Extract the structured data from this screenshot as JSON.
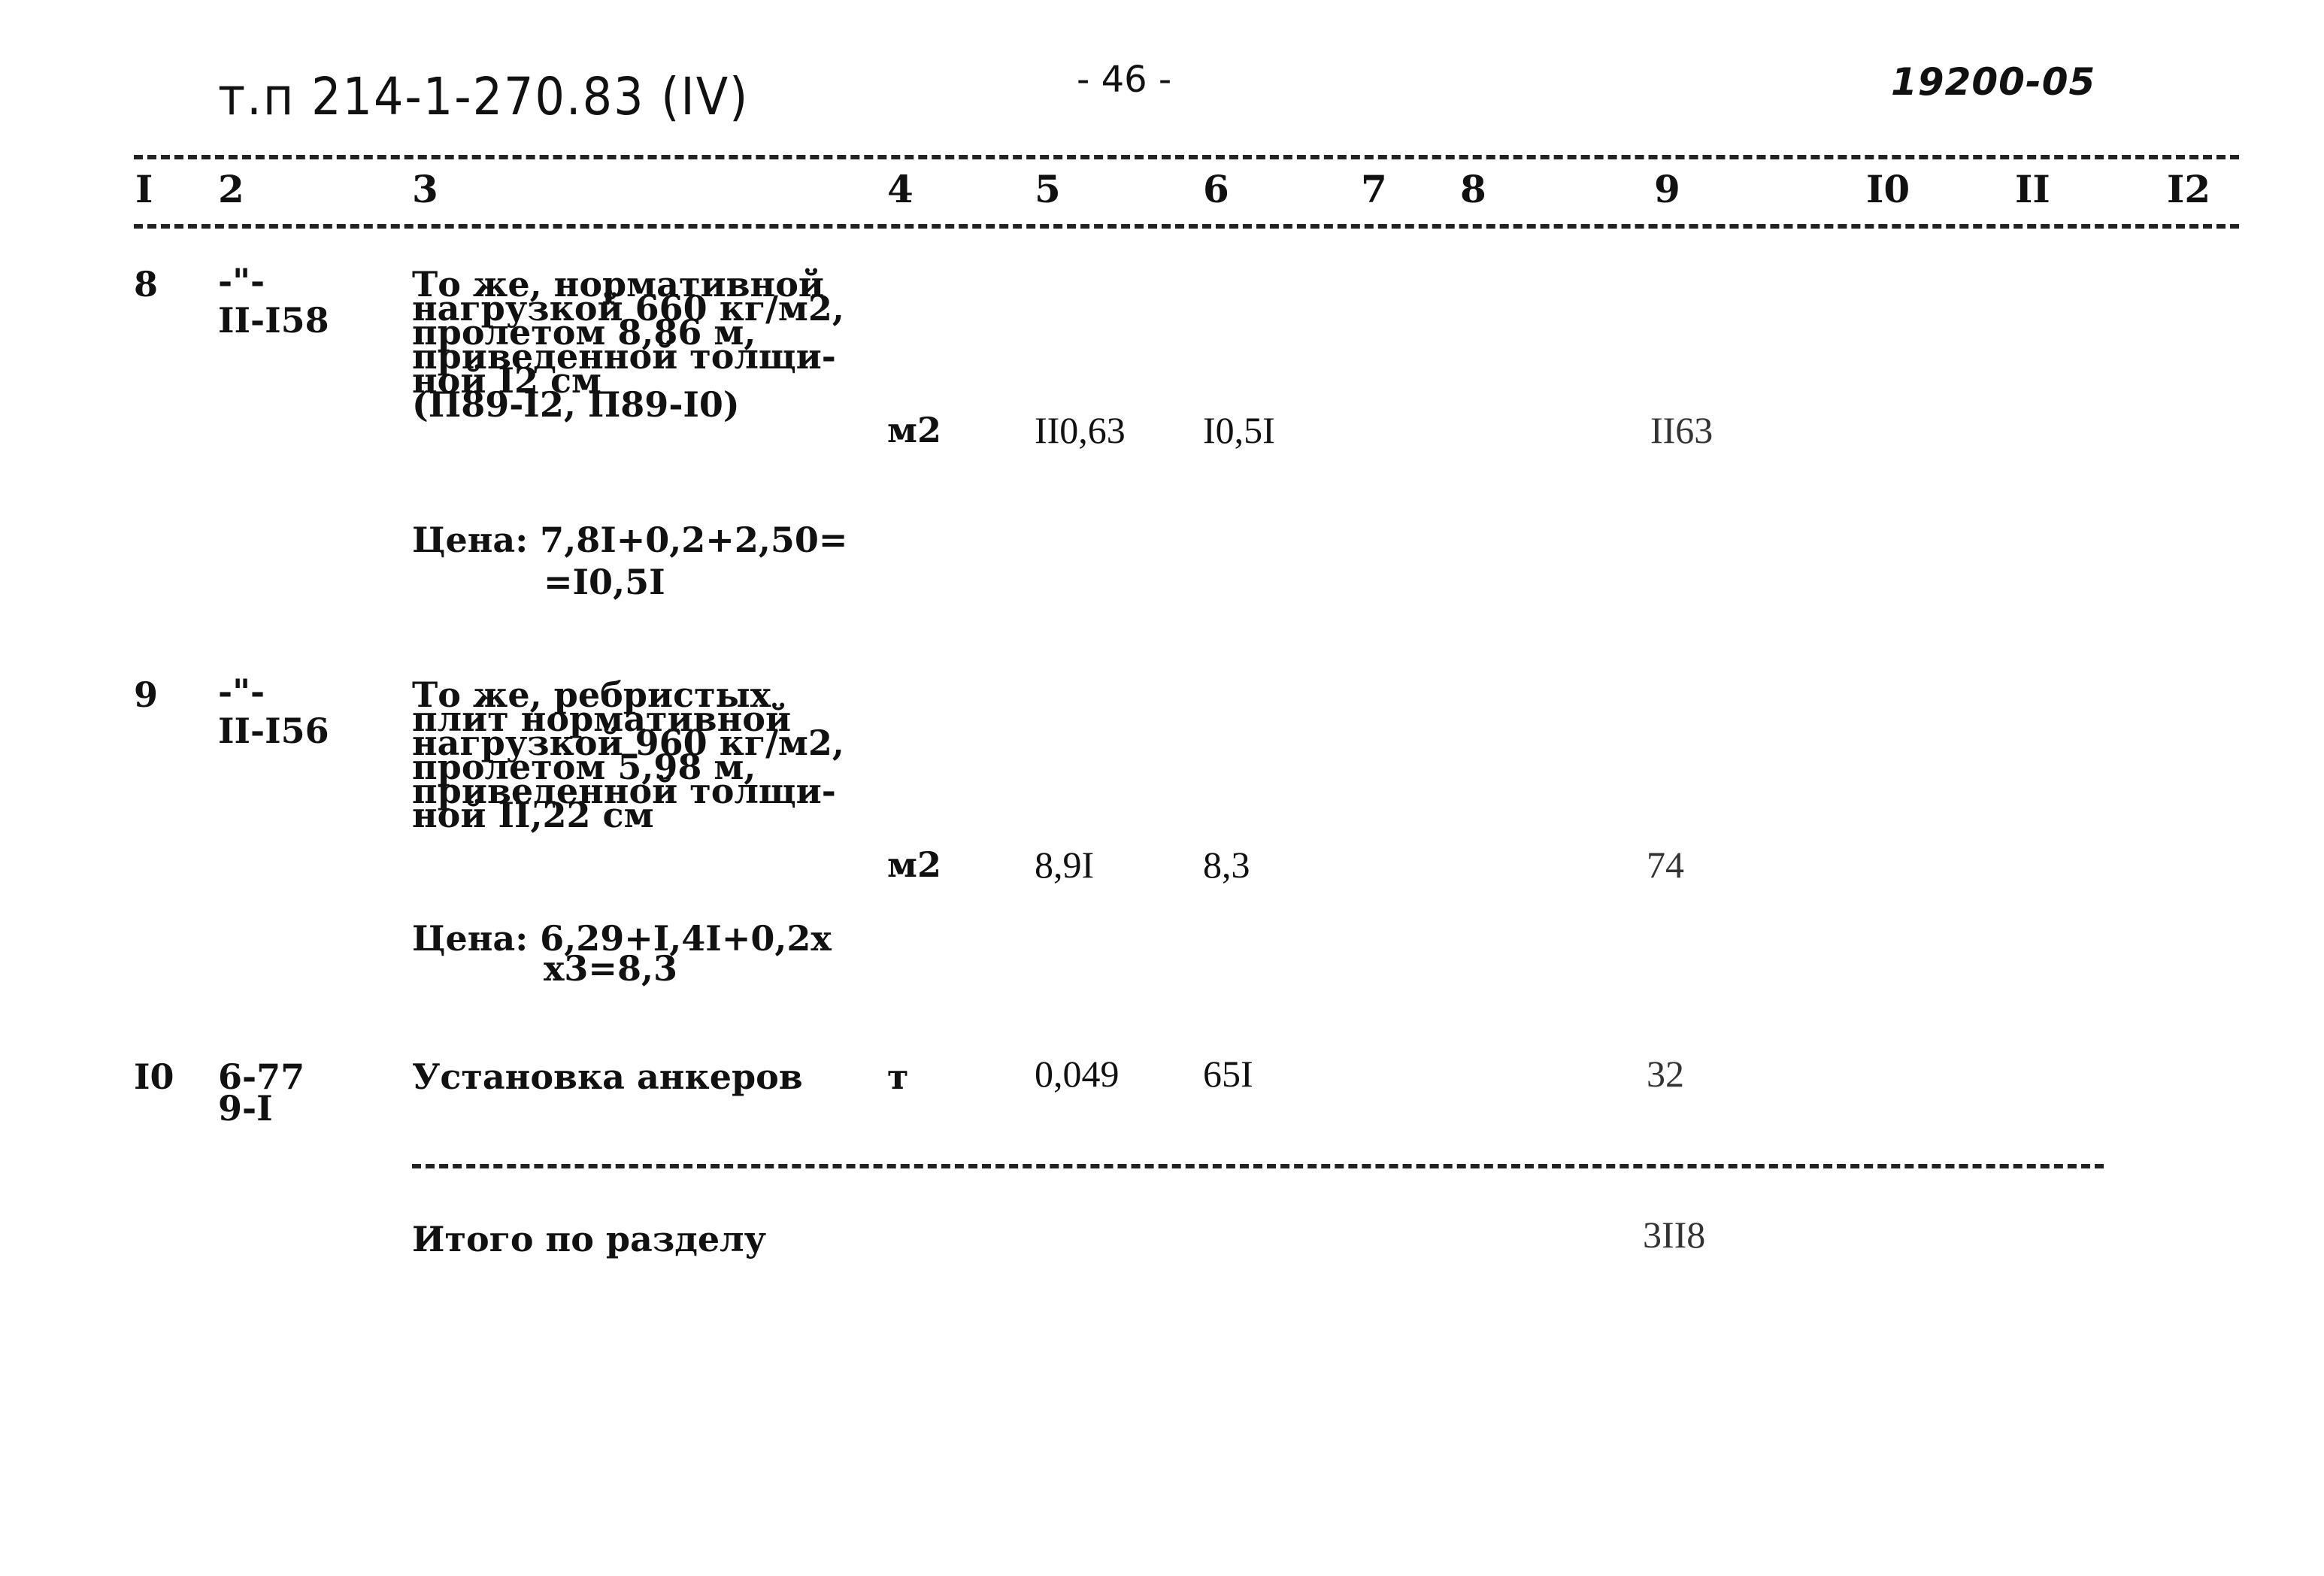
{
  "header": {
    "doc_ref": "т.п 214-1-270.83 (IV)",
    "page": "- 46 -",
    "code": "19200-05"
  },
  "columns": [
    "I",
    "2",
    "3",
    "4",
    "5",
    "6",
    "7",
    "8",
    "9",
    "I0",
    "II",
    "I2"
  ],
  "rows": [
    {
      "no": "8",
      "code_line1": "-\"-",
      "code_line2": "II-I58",
      "description": [
        "То же, нормативной",
        "нагрузкой 660 кг/м2,",
        "пролетом 8,86 м,",
        "приведенной толщи-",
        "ной I2 см",
        "(П89-I2, П89-I0)"
      ],
      "unit": "м2",
      "quantity": "II0,63",
      "price": "I0,5I",
      "total": "II63",
      "price_calc": [
        "Цена: 7,8I+0,2+2,50=",
        "=I0,5I"
      ]
    },
    {
      "no": "9",
      "code_line1": "-\"-",
      "code_line2": "II-I56",
      "description": [
        "То же, ребристых",
        "плит нормативной",
        "нагрузкой 960 кг/м2,",
        "пролетом 5,98 м,",
        "приведенной толщи-",
        "ной II,22 см"
      ],
      "unit": "м2",
      "quantity": "8,9I",
      "price": "8,3",
      "total": "74",
      "price_calc": [
        "Цена: 6,29+I,4I+0,2х",
        "х3=8,3"
      ]
    },
    {
      "no": "I0",
      "code_line1": "6-77",
      "code_line2": "9-I",
      "description": [
        "Установка анкеров"
      ],
      "unit": "т",
      "quantity": "0,049",
      "price": "65I",
      "total": "32",
      "price_calc": []
    }
  ],
  "summary": {
    "label": "Итого по разделу",
    "total": "3II8"
  }
}
